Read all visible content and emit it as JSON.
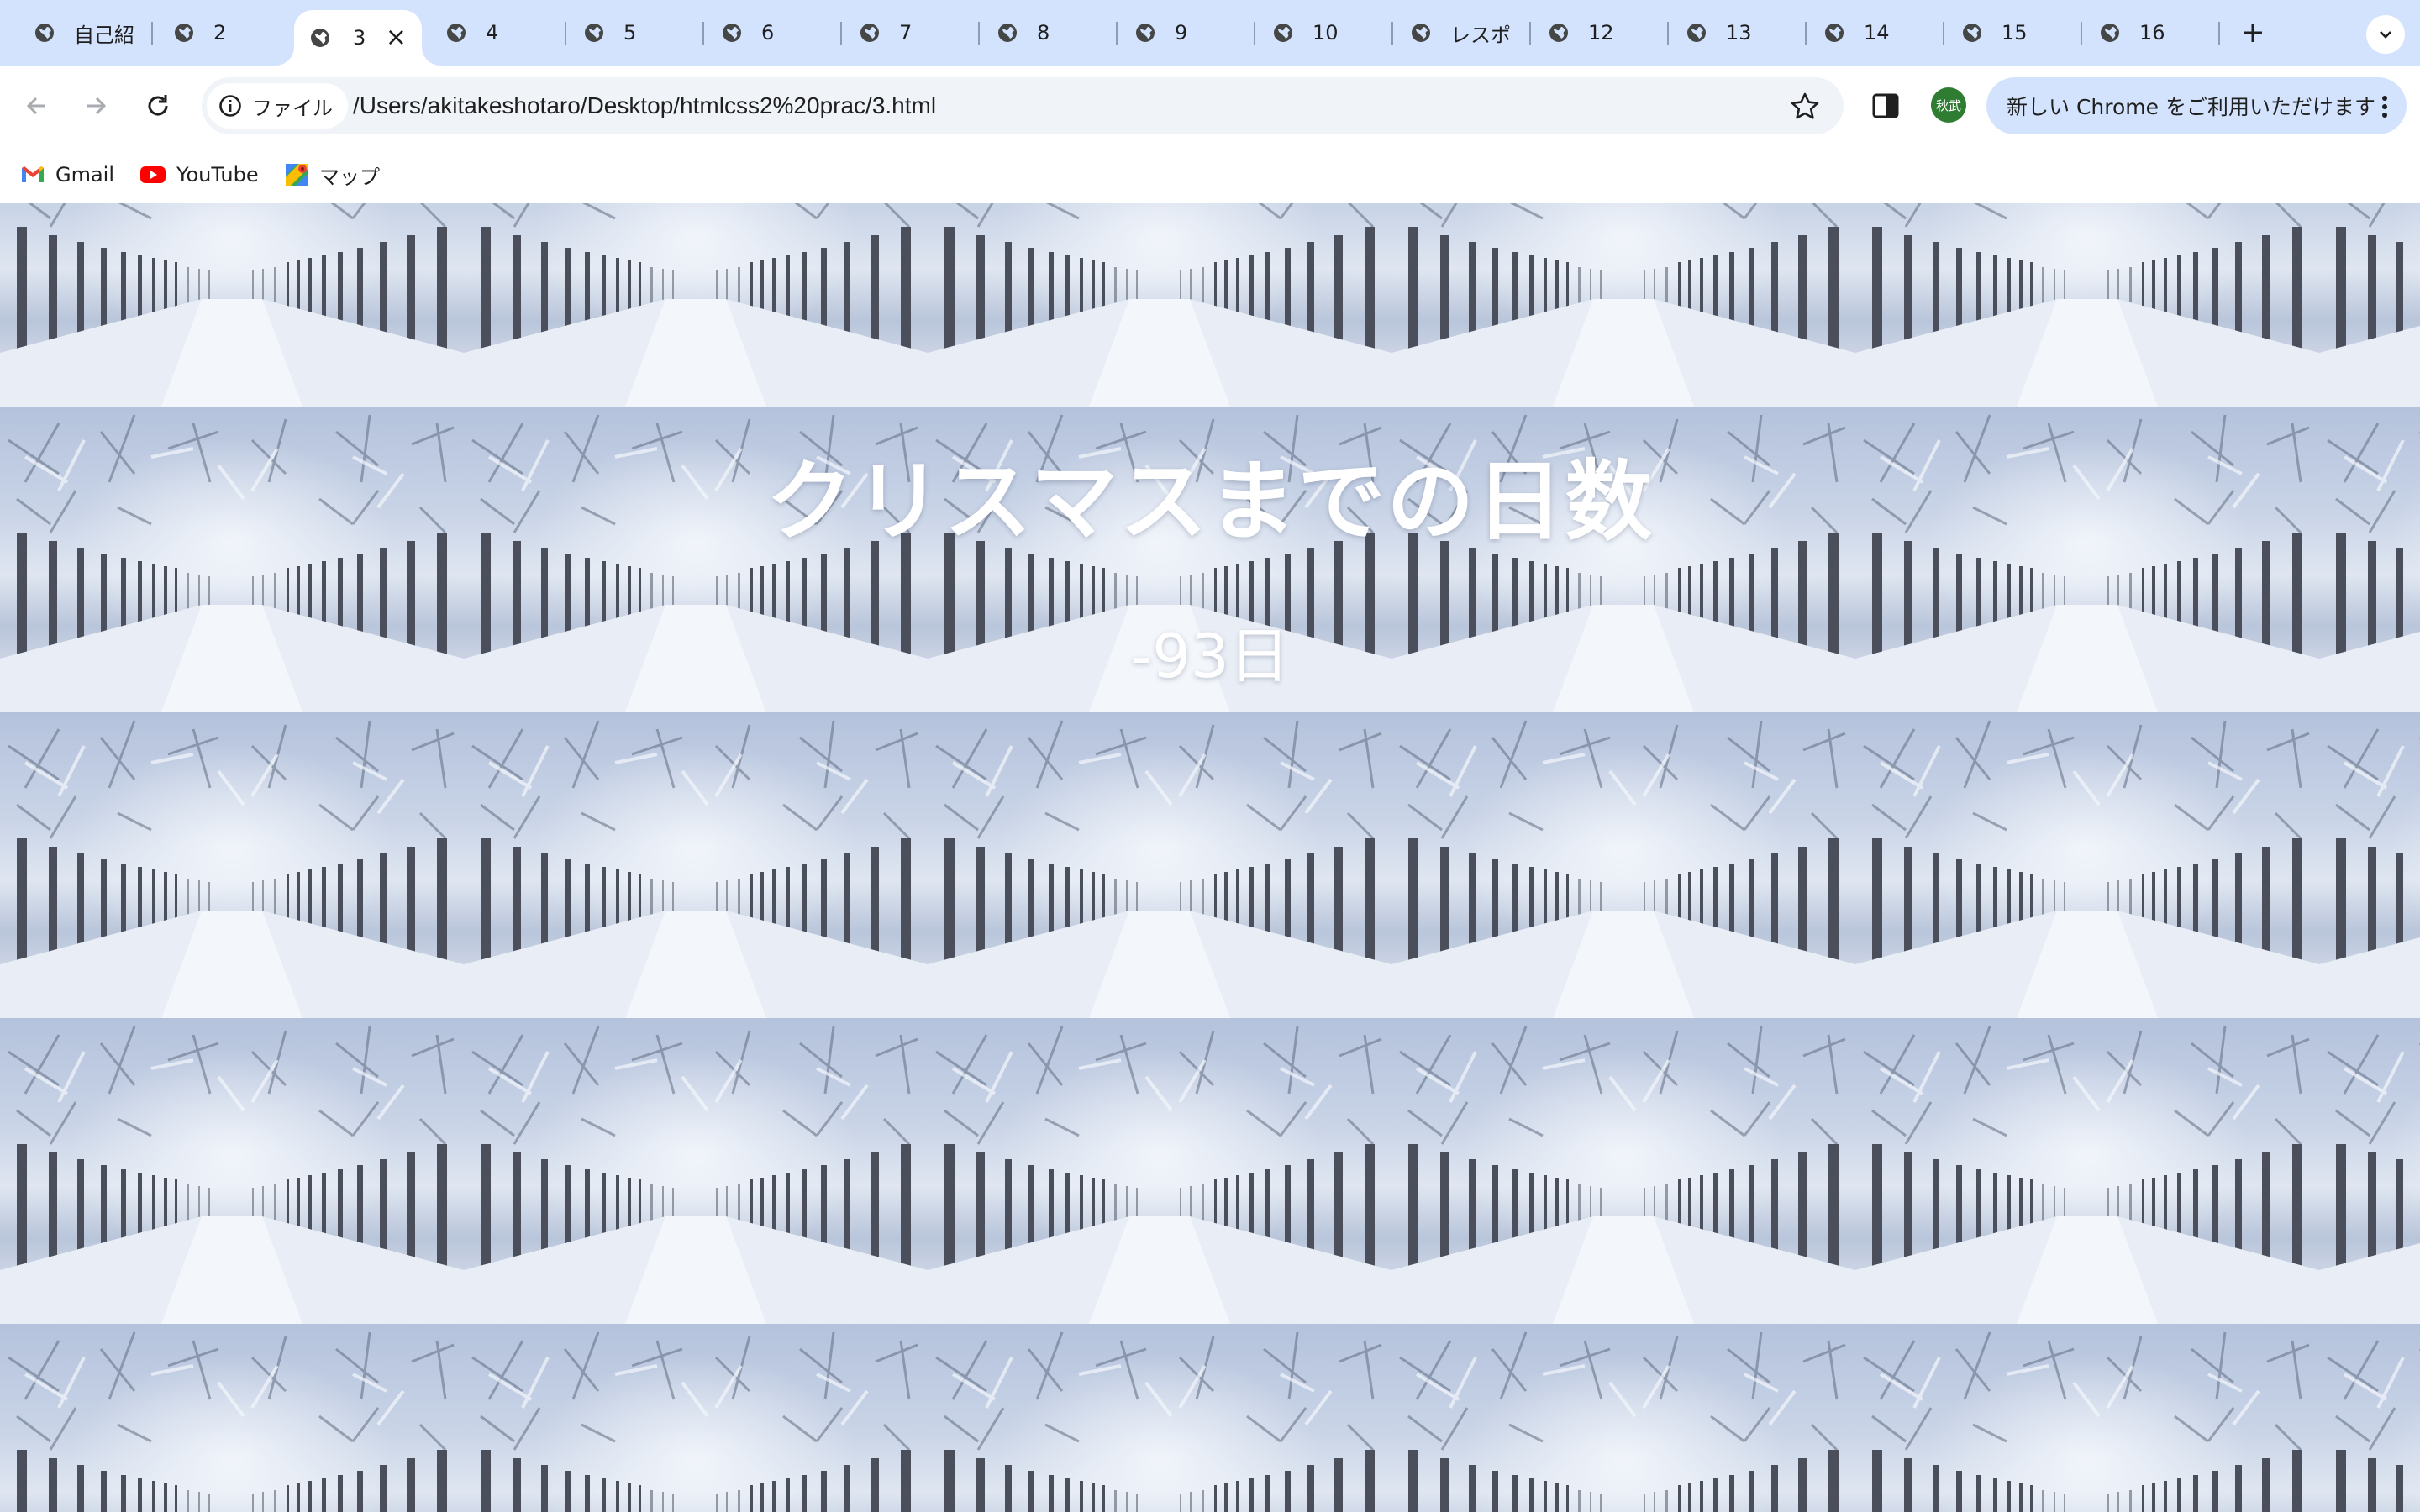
{
  "tabs": [
    {
      "title": "自己紹",
      "active": false
    },
    {
      "title": "2",
      "active": false
    },
    {
      "title": "3",
      "active": true
    },
    {
      "title": "4",
      "active": false
    },
    {
      "title": "5",
      "active": false
    },
    {
      "title": "6",
      "active": false
    },
    {
      "title": "7",
      "active": false
    },
    {
      "title": "8",
      "active": false
    },
    {
      "title": "9",
      "active": false
    },
    {
      "title": "10",
      "active": false
    },
    {
      "title": "レスポ",
      "active": false
    },
    {
      "title": "12",
      "active": false
    },
    {
      "title": "13",
      "active": false
    },
    {
      "title": "14",
      "active": false
    },
    {
      "title": "15",
      "active": false
    },
    {
      "title": "16",
      "active": false
    }
  ],
  "tab_icons": {
    "favicon": "globe-icon",
    "close": "close-icon",
    "new_tab": "plus-icon",
    "tab_search": "chevron-down-icon"
  },
  "toolbar": {
    "site_info_label": "ファイル",
    "url": "/Users/akitakeshotaro/Desktop/htmlcss2%20prac/3.html",
    "avatar_text": "秋武",
    "update_label": "新しい Chrome をご利用いただけます"
  },
  "bookmarks": [
    {
      "label": "Gmail",
      "icon": "gmail-icon"
    },
    {
      "label": "YouTube",
      "icon": "youtube-icon"
    },
    {
      "label": "マップ",
      "icon": "maps-icon"
    }
  ],
  "page": {
    "title": "クリスマスまでの日数",
    "countdown": "-93日"
  },
  "colors": {
    "tabstrip_bg": "#d3e3fd",
    "omnibox_bg": "#f0f4f9",
    "avatar_bg": "#2e7d32",
    "update_pill_bg": "#d3e3fd",
    "page_text": "#ffffff"
  }
}
